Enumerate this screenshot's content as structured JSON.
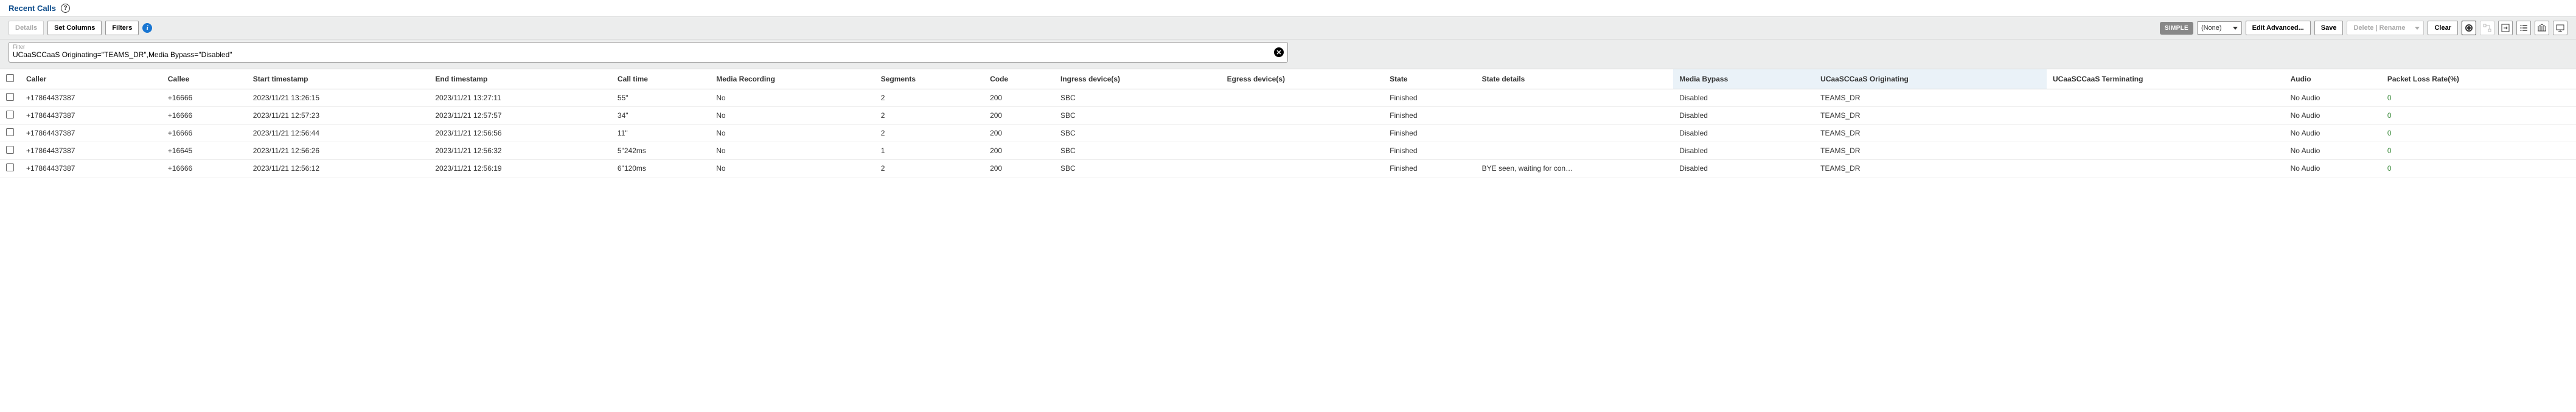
{
  "header": {
    "title": "Recent Calls"
  },
  "toolbar": {
    "details": "Details",
    "set_columns": "Set Columns",
    "filters": "Filters",
    "simple": "SIMPLE",
    "preset": "(None)",
    "edit_advanced": "Edit Advanced...",
    "save": "Save",
    "delete_rename": "Delete | Rename",
    "clear": "Clear"
  },
  "filter": {
    "label": "Filter",
    "value": "UCaaSCCaaS Originating=\"TEAMS_DR\",Media Bypass=\"Disabled\""
  },
  "columns": [
    "Caller",
    "Callee",
    "Start timestamp",
    "End timestamp",
    "Call time",
    "Media Recording",
    "Segments",
    "Code",
    "Ingress device(s)",
    "Egress device(s)",
    "State",
    "State details",
    "Media Bypass",
    "UCaaSCCaaS Originating",
    "UCaaSCCaaS Terminating",
    "Audio",
    "Packet Loss Rate(%)"
  ],
  "highlight_cols": [
    12,
    13
  ],
  "rows": [
    {
      "caller": "+17864437387",
      "callee": "+16666",
      "start": "2023/11/21 13:26:15",
      "end": "2023/11/21 13:27:11",
      "time": "55\"",
      "rec": "No",
      "seg": "2",
      "code": "200",
      "ingress": "SBC",
      "egress": "",
      "state": "Finished",
      "details": "",
      "bypass": "Disabled",
      "orig": "TEAMS_DR",
      "term": "",
      "audio": "No Audio",
      "loss": "0"
    },
    {
      "caller": "+17864437387",
      "callee": "+16666",
      "start": "2023/11/21 12:57:23",
      "end": "2023/11/21 12:57:57",
      "time": "34\"",
      "rec": "No",
      "seg": "2",
      "code": "200",
      "ingress": "SBC",
      "egress": "",
      "state": "Finished",
      "details": "",
      "bypass": "Disabled",
      "orig": "TEAMS_DR",
      "term": "",
      "audio": "No Audio",
      "loss": "0"
    },
    {
      "caller": "+17864437387",
      "callee": "+16666",
      "start": "2023/11/21 12:56:44",
      "end": "2023/11/21 12:56:56",
      "time": "11\"",
      "rec": "No",
      "seg": "2",
      "code": "200",
      "ingress": "SBC",
      "egress": "",
      "state": "Finished",
      "details": "",
      "bypass": "Disabled",
      "orig": "TEAMS_DR",
      "term": "",
      "audio": "No Audio",
      "loss": "0"
    },
    {
      "caller": "+17864437387",
      "callee": "+16645",
      "start": "2023/11/21 12:56:26",
      "end": "2023/11/21 12:56:32",
      "time": "5\"242ms",
      "rec": "No",
      "seg": "1",
      "code": "200",
      "ingress": "SBC",
      "egress": "",
      "state": "Finished",
      "details": "",
      "bypass": "Disabled",
      "orig": "TEAMS_DR",
      "term": "",
      "audio": "No Audio",
      "loss": "0"
    },
    {
      "caller": "+17864437387",
      "callee": "+16666",
      "start": "2023/11/21 12:56:12",
      "end": "2023/11/21 12:56:19",
      "time": "6\"120ms",
      "rec": "No",
      "seg": "2",
      "code": "200",
      "ingress": "SBC",
      "egress": "",
      "state": "Finished",
      "details": "BYE seen, waiting for con…",
      "bypass": "Disabled",
      "orig": "TEAMS_DR",
      "term": "",
      "audio": "No Audio",
      "loss": "0"
    }
  ]
}
